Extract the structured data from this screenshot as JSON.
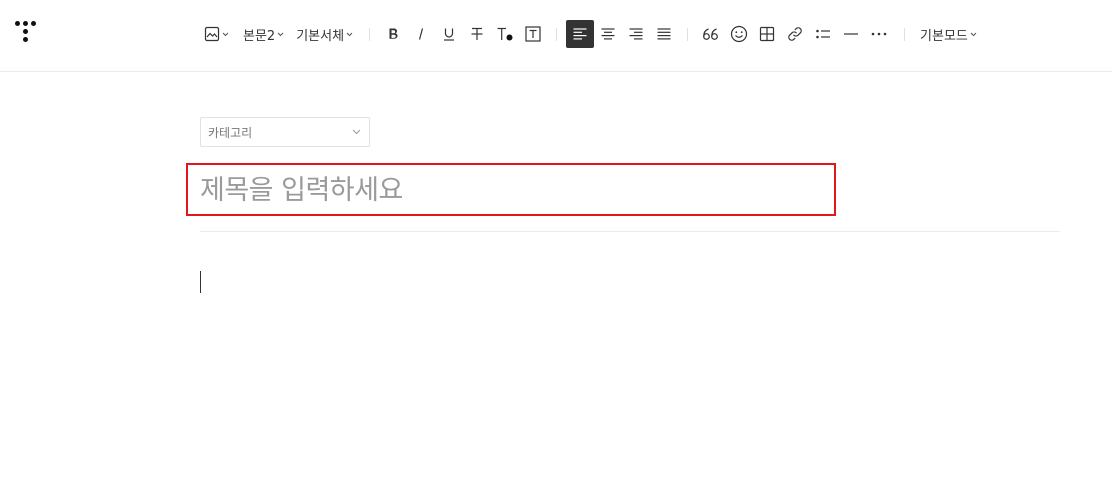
{
  "toolbar": {
    "image_icon": "image-icon",
    "paragraph_style": "본문2",
    "font_family": "기본서체",
    "buttons": [
      {
        "name": "bold",
        "icon": "bold-icon"
      },
      {
        "name": "italic",
        "icon": "italic-icon"
      },
      {
        "name": "underline",
        "icon": "underline-icon"
      },
      {
        "name": "strikethrough",
        "icon": "strikethrough-icon"
      },
      {
        "name": "text-color",
        "icon": "text-color-icon"
      },
      {
        "name": "text-background",
        "icon": "text-background-icon"
      }
    ],
    "align_active": "left",
    "mode_label": "기본모드"
  },
  "editor": {
    "category_label": "카테고리",
    "title_placeholder": "제목을 입력하세요",
    "title_value": "",
    "body_value": ""
  },
  "colors": {
    "highlight_border": "#e0171b",
    "active_button_bg": "#333333",
    "divider": "#ebebeb"
  }
}
